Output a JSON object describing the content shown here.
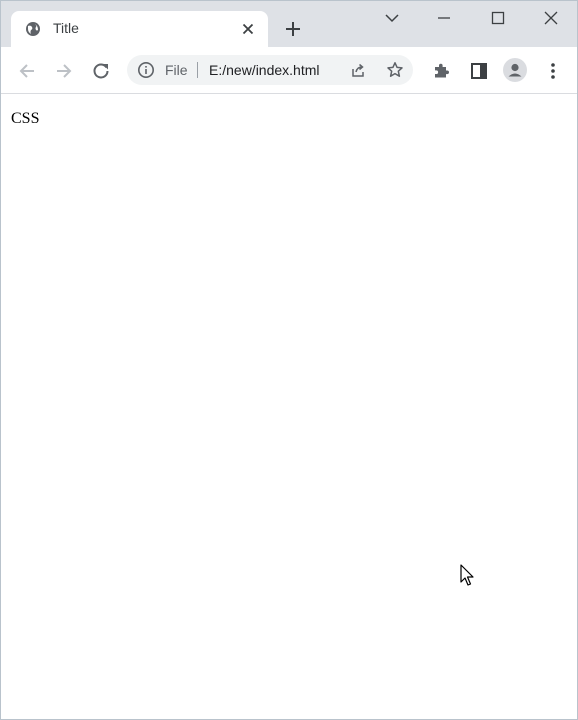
{
  "tab": {
    "title": "Title",
    "favicon": "globe-icon"
  },
  "window_controls": [
    "tab-search-icon",
    "minimize-icon",
    "maximize-icon",
    "close-icon"
  ],
  "toolbar": {
    "back_icon": "arrow-left-icon",
    "forward_icon": "arrow-right-icon",
    "reload_icon": "reload-icon",
    "omnibox": {
      "scheme_label": "File",
      "url": "E:/new/index.html"
    },
    "extensions_icon": "puzzle-icon",
    "side_panel_icon": "side-panel-icon",
    "profile_icon": "avatar-icon",
    "menu_icon": "kebab-menu-icon"
  },
  "page": {
    "text": "CSS"
  },
  "colors": {
    "tabstrip_bg": "#dee1e6",
    "omnibox_bg": "#f1f3f4",
    "icon": "#5f6368"
  }
}
